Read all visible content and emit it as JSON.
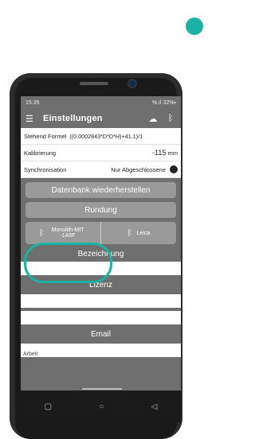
{
  "status_bar": {
    "time": "15:35",
    "indicators": "%.ıl 32%▪"
  },
  "app_bar": {
    "title": "Einstellungen",
    "menu_icon": "menu-icon",
    "cloud_icon": "cloud-upload-icon",
    "bluetooth_icon": "bluetooth-settings-icon"
  },
  "settings": {
    "stehend_label": "Stehend Formel",
    "stehend_value": "((0.0002843*D*D*H)+41.1)/1",
    "kalibrierung_label": "Kalibrierung",
    "kalibrierung_value": "-115",
    "kalibrierung_unit": "mm",
    "sync_label": "Synchronisation",
    "sync_value": "Nur Abgeschlossene"
  },
  "buttons": {
    "restore": "Datenbank wiederherstellen",
    "rounding": "Rundung"
  },
  "bluetooth": {
    "device1": "Monolith-MIT -1A5F",
    "device2": "Leica"
  },
  "sections": {
    "bezeichnung": "Bezeichnung",
    "lizenz": "Lizenz",
    "email": "Email"
  },
  "fields": {
    "arbeit": "Arbeit"
  },
  "colors": {
    "accent": "#1bb2a6",
    "screen_bg": "#6f6f6f",
    "button_bg": "#9a9a9a"
  }
}
